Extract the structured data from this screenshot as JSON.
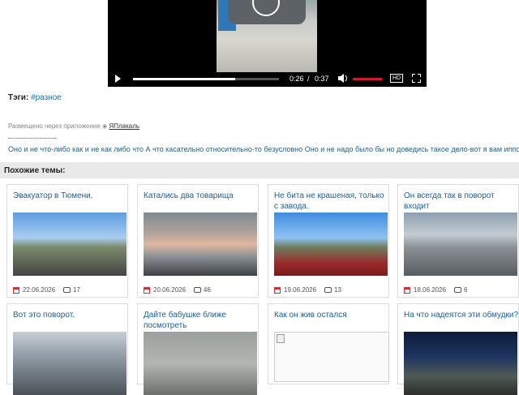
{
  "video": {
    "time_current": "0:26",
    "time_separator": "/",
    "time_duration": "0:37",
    "progress": 0.7,
    "hd_label": "HD",
    "accent_color": "#d0192a"
  },
  "tags": {
    "label": "Тэги:",
    "tag": "#разное"
  },
  "posted": {
    "text": "Размещено через приложение",
    "app": "ЯПлакаль"
  },
  "separator": "--------------------",
  "quote": "Оно и не что-либо как и не как либо что А что касательно относительно-то безусловно Оно и не надо было бы но доведись такое дело-вот я вам иппохалуйс",
  "similar": {
    "title": "Похожие темы:",
    "items": [
      {
        "title": "Эвакуатор в Тюмени.",
        "date": "22.06.2026",
        "comments": "17"
      },
      {
        "title": "Катались два товарища",
        "date": "20.06.2026",
        "comments": "46"
      },
      {
        "title": "Не бита не крашеная, только с завода.",
        "date": "19.06.2026",
        "comments": "13"
      },
      {
        "title": "Он всегда так в поворот входит",
        "date": "18.06.2026",
        "comments": "6"
      },
      {
        "title": "Вот это поворот."
      },
      {
        "title": "Дайте бабушке ближе посмотреть"
      },
      {
        "title": "Как он жив остался"
      },
      {
        "title": "На что надеятся эти обмудки?"
      }
    ]
  }
}
